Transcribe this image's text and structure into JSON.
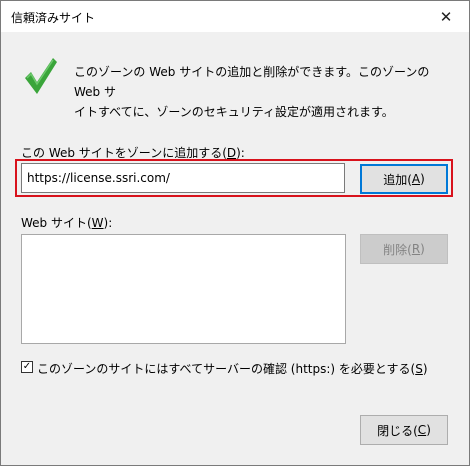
{
  "window": {
    "title": "信頼済みサイト",
    "close_glyph": "✕"
  },
  "description": {
    "line1": "このゾーンの Web サイトの追加と削除ができます。このゾーンの Web サ",
    "line2": "イトすべてに、ゾーンのセキュリティ設定が適用されます。"
  },
  "add_section": {
    "label_prefix": "この Web サイトをゾーンに追加する(",
    "label_key": "D",
    "label_suffix": "):",
    "url_value": "https://license.ssri.com/",
    "add_button_prefix": "追加(",
    "add_button_key": "A",
    "add_button_suffix": ")"
  },
  "sites_section": {
    "label_prefix": "Web サイト(",
    "label_key": "W",
    "label_suffix": "):",
    "items": [],
    "remove_button_prefix": "削除(",
    "remove_button_key": "R",
    "remove_button_suffix": ")"
  },
  "https_option": {
    "checked": true,
    "check_glyph": "✓",
    "label_prefix": "このゾーンのサイトにはすべてサーバーの確認 (https:) を必要とする(",
    "label_key": "S",
    "label_suffix": ")"
  },
  "footer": {
    "close_button_prefix": "閉じる(",
    "close_button_key": "C",
    "close_button_suffix": ")"
  },
  "colors": {
    "highlight_frame": "#d8121c",
    "check_icon": "#3aa53a",
    "default_button_border": "#0078d7"
  }
}
